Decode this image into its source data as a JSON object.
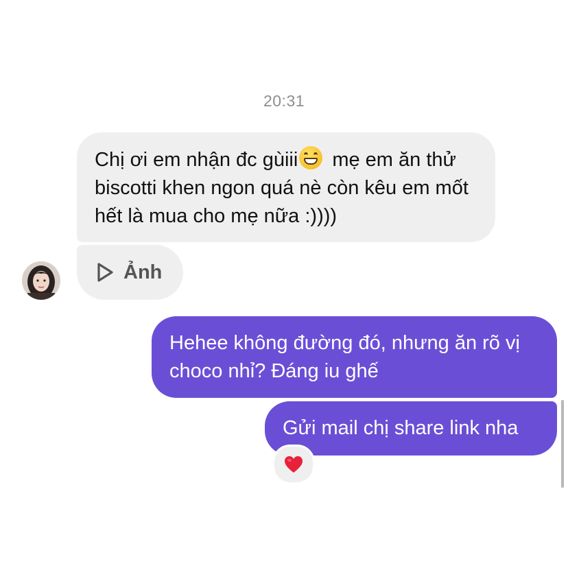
{
  "thread": {
    "timestamp": "20:31"
  },
  "messages": {
    "incoming_1": {
      "text_before_emoji": "Chị ơi em nhận đc gùiii",
      "emoji": "grinning-face-with-smiling-eyes",
      "text_after_emoji": " mẹ em ăn thử biscotti khen ngon quá nè còn kêu em mốt hết là mua cho mẹ nữa :))))"
    },
    "incoming_2": {
      "media_icon": "play-icon",
      "label": "Ảnh"
    },
    "outgoing_1": {
      "text": "Hehee không đường đó, nhưng ăn rõ vị choco nhỉ? Đáng iu ghế"
    },
    "outgoing_2": {
      "text": "Gửi mail chị share link nha"
    },
    "reaction": {
      "icon": "heart-icon",
      "color": "#e8213a"
    }
  },
  "colors": {
    "incoming_bubble": "#efefef",
    "outgoing_bubble": "#6a4fd6",
    "timestamp": "#8e8e8e"
  }
}
